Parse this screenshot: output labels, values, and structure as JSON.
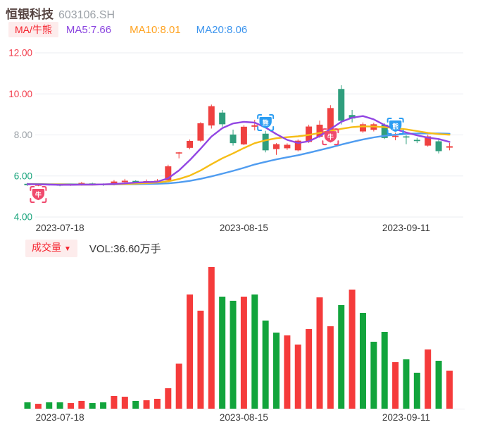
{
  "header": {
    "title": "恒银科技",
    "code": "603106.SH"
  },
  "legend": {
    "mode_badge": "MA/牛熊",
    "ma5": "MA5:7.66",
    "ma10": "MA10:8.01",
    "ma20": "MA20:8.06"
  },
  "volume_header": {
    "dropdown_label": "成交量",
    "dropdown_arrow": "▼",
    "vol_value": "VOL:36.60万手"
  },
  "colors": {
    "up": "#ef4140",
    "down": "#2f9e7d",
    "vol_up": "#f53b3b",
    "vol_down": "#12a43c",
    "ma5_line": "#9246e3",
    "ma10_line": "#f6bd16",
    "ma20_line": "#4f9cf0",
    "bull_marker": "#f04a6e",
    "bear_marker": "#2b9df2",
    "grid": "#ebeef2",
    "date_label": "#3a3a3a",
    "tick_red": "#f23c4b",
    "tick_gray": "#9aa0a6",
    "tick_green": "#18a47c"
  },
  "chart_data": [
    {
      "type": "candlestick",
      "title": "恒银科技 603106.SH 日K线 (MA/牛熊)",
      "ylim": [
        4.0,
        12.6
      ],
      "grid": true,
      "y_ticks": [
        {
          "label": "12.00",
          "value": 12,
          "color": "#f23c4b"
        },
        {
          "label": "10.00",
          "value": 10,
          "color": "#f23c4b"
        },
        {
          "label": "8.00",
          "value": 8,
          "color": "#9aa0a6"
        },
        {
          "label": "6.00",
          "value": 6,
          "color": "#18a47c"
        },
        {
          "label": "4.00",
          "value": 4,
          "color": "#18a47c"
        }
      ],
      "x_ticks": [
        {
          "label": "2023-07-18",
          "index": 3
        },
        {
          "label": "2023-08-15",
          "index": 20
        },
        {
          "label": "2023-09-11",
          "index": 35
        }
      ],
      "candles": [
        {
          "o": 5.62,
          "h": 5.66,
          "l": 5.52,
          "c": 5.55,
          "d": "d"
        },
        {
          "o": 5.53,
          "h": 5.61,
          "l": 5.5,
          "c": 5.58,
          "d": "u"
        },
        {
          "o": 5.6,
          "h": 5.63,
          "l": 5.53,
          "c": 5.55,
          "d": "d"
        },
        {
          "o": 5.58,
          "h": 5.61,
          "l": 5.5,
          "c": 5.53,
          "d": "d"
        },
        {
          "o": 5.54,
          "h": 5.63,
          "l": 5.52,
          "c": 5.6,
          "d": "u"
        },
        {
          "o": 5.56,
          "h": 5.71,
          "l": 5.53,
          "c": 5.66,
          "d": "u"
        },
        {
          "o": 5.64,
          "h": 5.67,
          "l": 5.54,
          "c": 5.57,
          "d": "d"
        },
        {
          "o": 5.6,
          "h": 5.64,
          "l": 5.52,
          "c": 5.55,
          "d": "d"
        },
        {
          "o": 5.57,
          "h": 5.8,
          "l": 5.54,
          "c": 5.73,
          "d": "u"
        },
        {
          "o": 5.7,
          "h": 5.86,
          "l": 5.65,
          "c": 5.77,
          "d": "u"
        },
        {
          "o": 5.76,
          "h": 5.79,
          "l": 5.62,
          "c": 5.67,
          "d": "d"
        },
        {
          "o": 5.67,
          "h": 5.83,
          "l": 5.6,
          "c": 5.75,
          "d": "u"
        },
        {
          "o": 5.7,
          "h": 5.85,
          "l": 5.64,
          "c": 5.77,
          "d": "u"
        },
        {
          "o": 5.79,
          "h": 6.55,
          "l": 5.75,
          "c": 6.47,
          "d": "u"
        },
        {
          "o": 7.1,
          "h": 7.17,
          "l": 6.86,
          "c": 7.15,
          "d": "u"
        },
        {
          "o": 7.37,
          "h": 7.78,
          "l": 7.3,
          "c": 7.71,
          "d": "u"
        },
        {
          "o": 7.72,
          "h": 8.62,
          "l": 7.66,
          "c": 8.57,
          "d": "u"
        },
        {
          "o": 8.46,
          "h": 9.48,
          "l": 8.31,
          "c": 9.4,
          "d": "u"
        },
        {
          "o": 9.09,
          "h": 9.22,
          "l": 8.4,
          "c": 8.52,
          "d": "d"
        },
        {
          "o": 8.02,
          "h": 8.26,
          "l": 7.48,
          "c": 7.6,
          "d": "d"
        },
        {
          "o": 7.54,
          "h": 8.48,
          "l": 7.5,
          "c": 8.4,
          "d": "u"
        },
        {
          "o": 8.4,
          "h": 8.74,
          "l": 8.22,
          "c": 8.47,
          "d": "u"
        },
        {
          "o": 8.06,
          "h": 8.2,
          "l": 7.15,
          "c": 7.25,
          "d": "d"
        },
        {
          "o": 7.31,
          "h": 7.6,
          "l": 7.03,
          "c": 7.55,
          "d": "u"
        },
        {
          "o": 7.35,
          "h": 7.59,
          "l": 7.27,
          "c": 7.52,
          "d": "u"
        },
        {
          "o": 7.25,
          "h": 7.78,
          "l": 7.2,
          "c": 7.72,
          "d": "u"
        },
        {
          "o": 7.66,
          "h": 8.5,
          "l": 7.61,
          "c": 8.41,
          "d": "u"
        },
        {
          "o": 7.91,
          "h": 8.7,
          "l": 7.86,
          "c": 8.5,
          "d": "u"
        },
        {
          "o": 8.02,
          "h": 9.45,
          "l": 7.96,
          "c": 9.31,
          "d": "u"
        },
        {
          "o": 10.24,
          "h": 10.42,
          "l": 8.51,
          "c": 8.69,
          "d": "d"
        },
        {
          "o": 8.97,
          "h": 9.22,
          "l": 8.61,
          "c": 8.8,
          "d": "d"
        },
        {
          "o": 8.17,
          "h": 8.61,
          "l": 8.1,
          "c": 8.52,
          "d": "u"
        },
        {
          "o": 8.25,
          "h": 8.59,
          "l": 8.17,
          "c": 8.52,
          "d": "u"
        },
        {
          "o": 8.5,
          "h": 8.56,
          "l": 7.8,
          "c": 7.85,
          "d": "d"
        },
        {
          "o": 7.9,
          "h": 8.11,
          "l": 7.74,
          "c": 7.96,
          "d": "u"
        },
        {
          "o": 7.93,
          "h": 7.98,
          "l": 7.55,
          "c": 7.9,
          "d": "d"
        },
        {
          "o": 7.76,
          "h": 7.86,
          "l": 7.6,
          "c": 7.7,
          "d": "d"
        },
        {
          "o": 7.48,
          "h": 8.01,
          "l": 7.43,
          "c": 7.93,
          "d": "u"
        },
        {
          "o": 7.69,
          "h": 7.76,
          "l": 7.1,
          "c": 7.21,
          "d": "d"
        },
        {
          "o": 7.38,
          "h": 7.61,
          "l": 7.25,
          "c": 7.45,
          "d": "u"
        }
      ],
      "series": [
        {
          "name": "MA5",
          "current": 7.66,
          "values": [
            5.6,
            5.59,
            5.58,
            5.57,
            5.57,
            5.58,
            5.58,
            5.59,
            5.61,
            5.64,
            5.68,
            5.7,
            5.72,
            5.89,
            6.27,
            6.77,
            7.33,
            7.92,
            8.33,
            8.56,
            8.64,
            8.6,
            8.36,
            8.04,
            7.76,
            7.61,
            7.69,
            7.94,
            8.29,
            8.64,
            8.84,
            8.92,
            8.76,
            8.48,
            8.28,
            8.12,
            7.98,
            7.87,
            7.8,
            7.66
          ]
        },
        {
          "name": "MA10",
          "current": 8.01,
          "values": [
            5.6,
            5.6,
            5.59,
            5.59,
            5.58,
            5.58,
            5.58,
            5.59,
            5.6,
            5.61,
            5.63,
            5.65,
            5.68,
            5.74,
            5.85,
            6.02,
            6.27,
            6.57,
            6.86,
            7.1,
            7.36,
            7.6,
            7.74,
            7.84,
            7.89,
            7.93,
            8.0,
            8.1,
            8.2,
            8.3,
            8.38,
            8.42,
            8.41,
            8.38,
            8.33,
            8.27,
            8.19,
            8.1,
            8.04,
            8.01
          ]
        },
        {
          "name": "MA20",
          "current": 8.06,
          "values": [
            5.61,
            5.61,
            5.6,
            5.6,
            5.6,
            5.59,
            5.59,
            5.59,
            5.59,
            5.6,
            5.6,
            5.61,
            5.62,
            5.64,
            5.69,
            5.76,
            5.86,
            5.98,
            6.11,
            6.25,
            6.4,
            6.56,
            6.69,
            6.81,
            6.91,
            7.01,
            7.13,
            7.26,
            7.39,
            7.53,
            7.66,
            7.78,
            7.88,
            7.96,
            8.01,
            8.05,
            8.07,
            8.08,
            8.07,
            8.06
          ]
        }
      ],
      "markers": [
        {
          "type": "bull",
          "glyph": "牛",
          "index": 1,
          "price": 5.1
        },
        {
          "type": "bear",
          "glyph": "熊",
          "index": 22,
          "price": 8.6
        },
        {
          "type": "bull",
          "glyph": "牛",
          "index": 28,
          "price": 7.91
        },
        {
          "type": "bear",
          "glyph": "熊",
          "index": 34,
          "price": 8.43
        }
      ]
    },
    {
      "type": "bar",
      "title": "成交量 (万手)",
      "ylabel": "VOL 万手",
      "ylim": [
        0,
        140
      ],
      "latest_vol": 36.6,
      "values": [
        6.1,
        4.7,
        6.1,
        6.1,
        5.4,
        7.5,
        5.4,
        6.1,
        12.2,
        11.5,
        7.5,
        8.1,
        9.5,
        19.7,
        43.4,
        109.9,
        94.3,
        136.3,
        107.8,
        103.8,
        107.8,
        109.9,
        84.8,
        73.2,
        70.5,
        61.7,
        76.6,
        107.1,
        79.3,
        99.7,
        114.6,
        92.2,
        64.4,
        73.9,
        44.8,
        47.5,
        34.6,
        57.0,
        46.1,
        36.6
      ],
      "dirs": [
        "d",
        "u",
        "d",
        "d",
        "u",
        "u",
        "d",
        "d",
        "u",
        "u",
        "d",
        "u",
        "u",
        "u",
        "u",
        "u",
        "u",
        "u",
        "d",
        "d",
        "u",
        "d",
        "d",
        "d",
        "u",
        "u",
        "u",
        "u",
        "u",
        "d",
        "u",
        "d",
        "d",
        "d",
        "u",
        "d",
        "d",
        "u",
        "d",
        "u"
      ],
      "x_ticks": [
        {
          "label": "2023-07-18",
          "index": 3
        },
        {
          "label": "2023-08-15",
          "index": 20
        },
        {
          "label": "2023-09-11",
          "index": 35
        }
      ]
    }
  ]
}
